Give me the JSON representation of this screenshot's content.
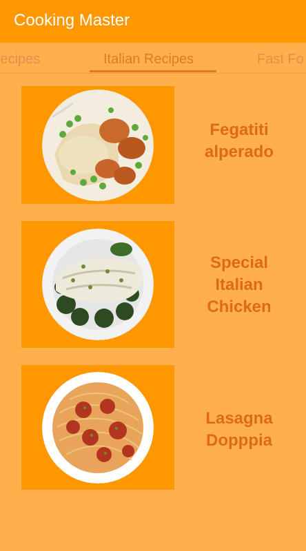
{
  "app": {
    "title": "Cooking Master"
  },
  "tabs": [
    {
      "label": "Recipes",
      "selected": false
    },
    {
      "label": "Italian Recipes",
      "selected": true
    },
    {
      "label": "Fast Fo",
      "selected": false
    }
  ],
  "recipes": [
    {
      "title_lines": [
        "Fegatiti",
        "alperado"
      ],
      "dish": "plate-chicken-potatoes-peas"
    },
    {
      "title_lines": [
        "Special",
        "Italian",
        "Chicken"
      ],
      "dish": "plate-chicken-greens"
    },
    {
      "title_lines": [
        "Lasagna",
        "Dopppia"
      ],
      "dish": "plate-spaghetti-meatballs"
    }
  ],
  "colors": {
    "appbar": "#FF9800",
    "background": "#FFB04C",
    "accent": "#E07A1F",
    "title_text": "#E06A10"
  }
}
